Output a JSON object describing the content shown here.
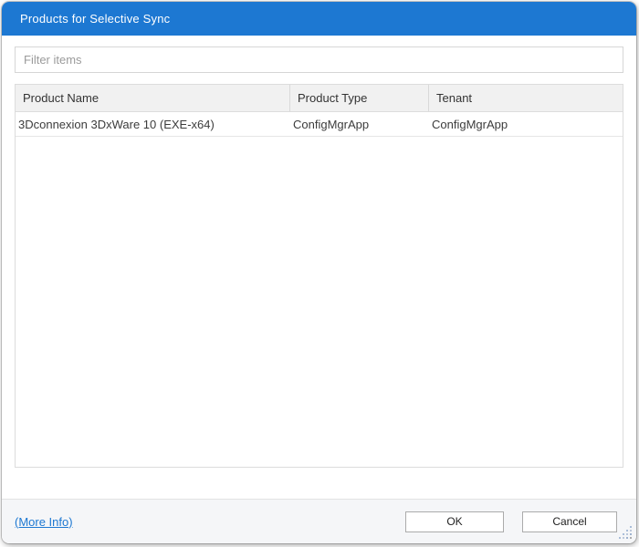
{
  "dialog": {
    "title": "Products for Selective Sync"
  },
  "filter": {
    "placeholder": "Filter items"
  },
  "table": {
    "columns": [
      "Product Name",
      "Product Type",
      "Tenant"
    ],
    "rows": [
      [
        "3Dconnexion 3DxWare 10 (EXE-x64)",
        "ConfigMgrApp",
        "ConfigMgrApp"
      ]
    ]
  },
  "footer": {
    "more_info_label": "(More Info)",
    "ok_label": "OK",
    "cancel_label": "Cancel"
  },
  "colors": {
    "titlebar": "#1d78d2",
    "link": "#1d78d2",
    "header_bg": "#f1f1f1",
    "footer_bg": "#f5f6f8"
  }
}
